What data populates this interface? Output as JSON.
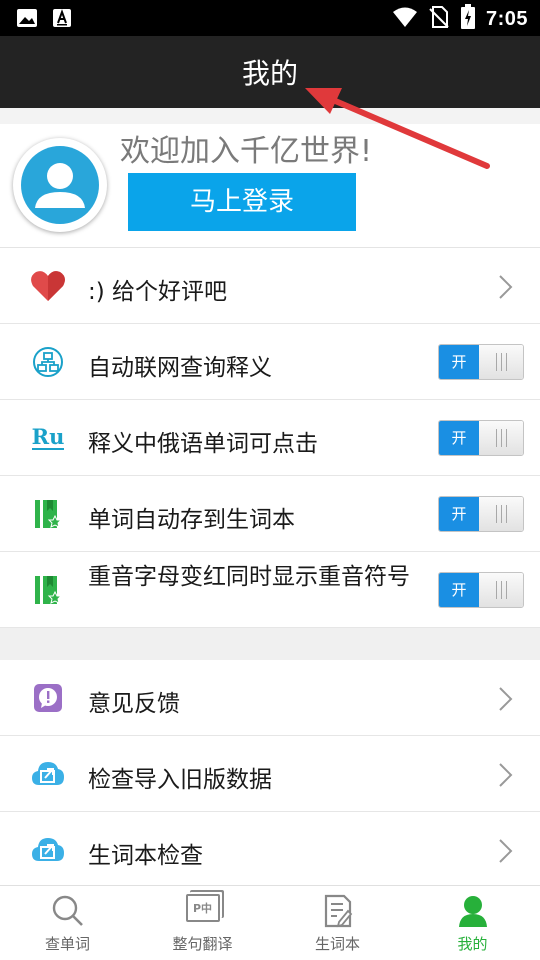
{
  "status_bar": {
    "time": "7:05"
  },
  "app_bar": {
    "title": "我的"
  },
  "profile": {
    "welcome_text": "欢迎加入千亿世界!",
    "login_button": "马上登录"
  },
  "settings": [
    {
      "label": ":) 给个好评吧",
      "icon": "heart-icon",
      "control": "chevron"
    },
    {
      "label": "自动联网查询释义",
      "icon": "network-icon",
      "control": "toggle",
      "toggle_text": "开"
    },
    {
      "label": "释义中俄语单词可点击",
      "icon": "ru-icon",
      "icon_text": "Ru",
      "control": "toggle",
      "toggle_text": "开"
    },
    {
      "label": "单词自动存到生词本",
      "icon": "vocab-book-icon",
      "control": "toggle",
      "toggle_text": "开"
    },
    {
      "label": "重音字母变红同时显示重音符号",
      "icon": "vocab-book-icon",
      "control": "toggle",
      "toggle_text": "开"
    }
  ],
  "more": [
    {
      "label": "意见反馈",
      "icon": "feedback-icon"
    },
    {
      "label": "检查导入旧版数据",
      "icon": "cloud-import-icon"
    },
    {
      "label": "生词本检查",
      "icon": "cloud-import-icon"
    }
  ],
  "bottom_nav": [
    {
      "label": "查单词",
      "icon": "search-icon",
      "active": false
    },
    {
      "label": "整句翻译",
      "icon": "translate-icon",
      "icon_text": "P中",
      "active": false
    },
    {
      "label": "生词本",
      "icon": "notebook-icon",
      "active": false
    },
    {
      "label": "我的",
      "icon": "person-icon",
      "active": true
    }
  ],
  "colors": {
    "app_bar": "#232323",
    "login_button": "#0aa4ea",
    "toggle_on": "#1a8fe3",
    "active_tab": "#27b03a",
    "heart": "#e04a4a",
    "annotation_arrow": "#e0393b"
  }
}
